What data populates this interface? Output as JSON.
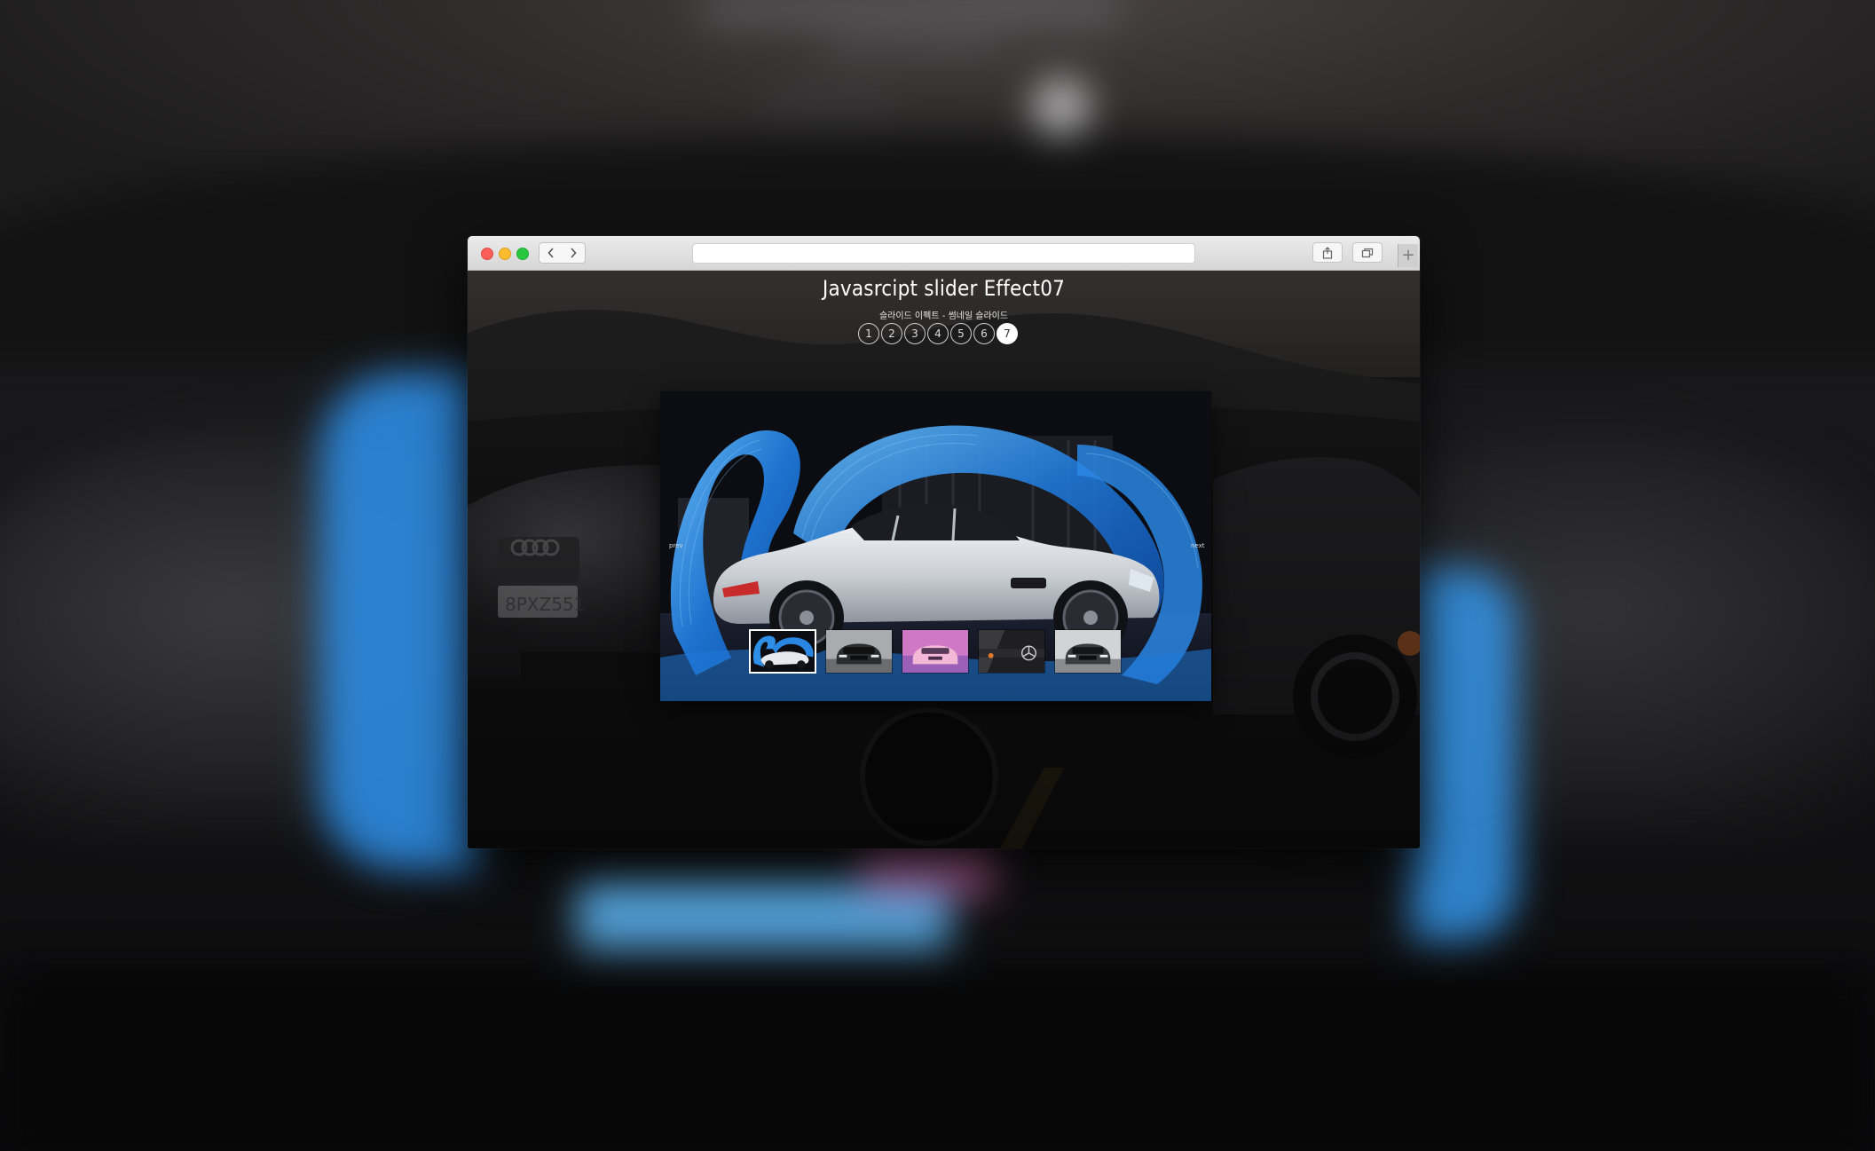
{
  "browser": {
    "url": "",
    "back_icon": "chevron-left-icon",
    "forward_icon": "chevron-right-icon",
    "share_icon": "share-icon",
    "tabs_icon": "tabs-icon",
    "new_tab_label": "+"
  },
  "page": {
    "title": "Javasrcipt slider Effect07",
    "subtitle": "슬라이드 이펙트 - 썸네일 슬라이드"
  },
  "pagination": {
    "items": [
      "1",
      "2",
      "3",
      "4",
      "5",
      "6",
      "7"
    ],
    "active_index": 6
  },
  "slider": {
    "prev_label": "prev",
    "next_label": "next",
    "thumbnails": [
      {
        "name": "thumb-blue-swirl-car",
        "active": true
      },
      {
        "name": "thumb-dark-car-front",
        "active": false
      },
      {
        "name": "thumb-pink-car",
        "active": false
      },
      {
        "name": "thumb-mercedes-logo",
        "active": false
      },
      {
        "name": "thumb-silver-car-front",
        "active": false
      }
    ]
  },
  "colors": {
    "accent_blue": "#2f8fe6",
    "active_dot": "#ffffff",
    "traffic_close": "#fc5f57",
    "traffic_min": "#fdbc2e",
    "traffic_max": "#29c840"
  }
}
